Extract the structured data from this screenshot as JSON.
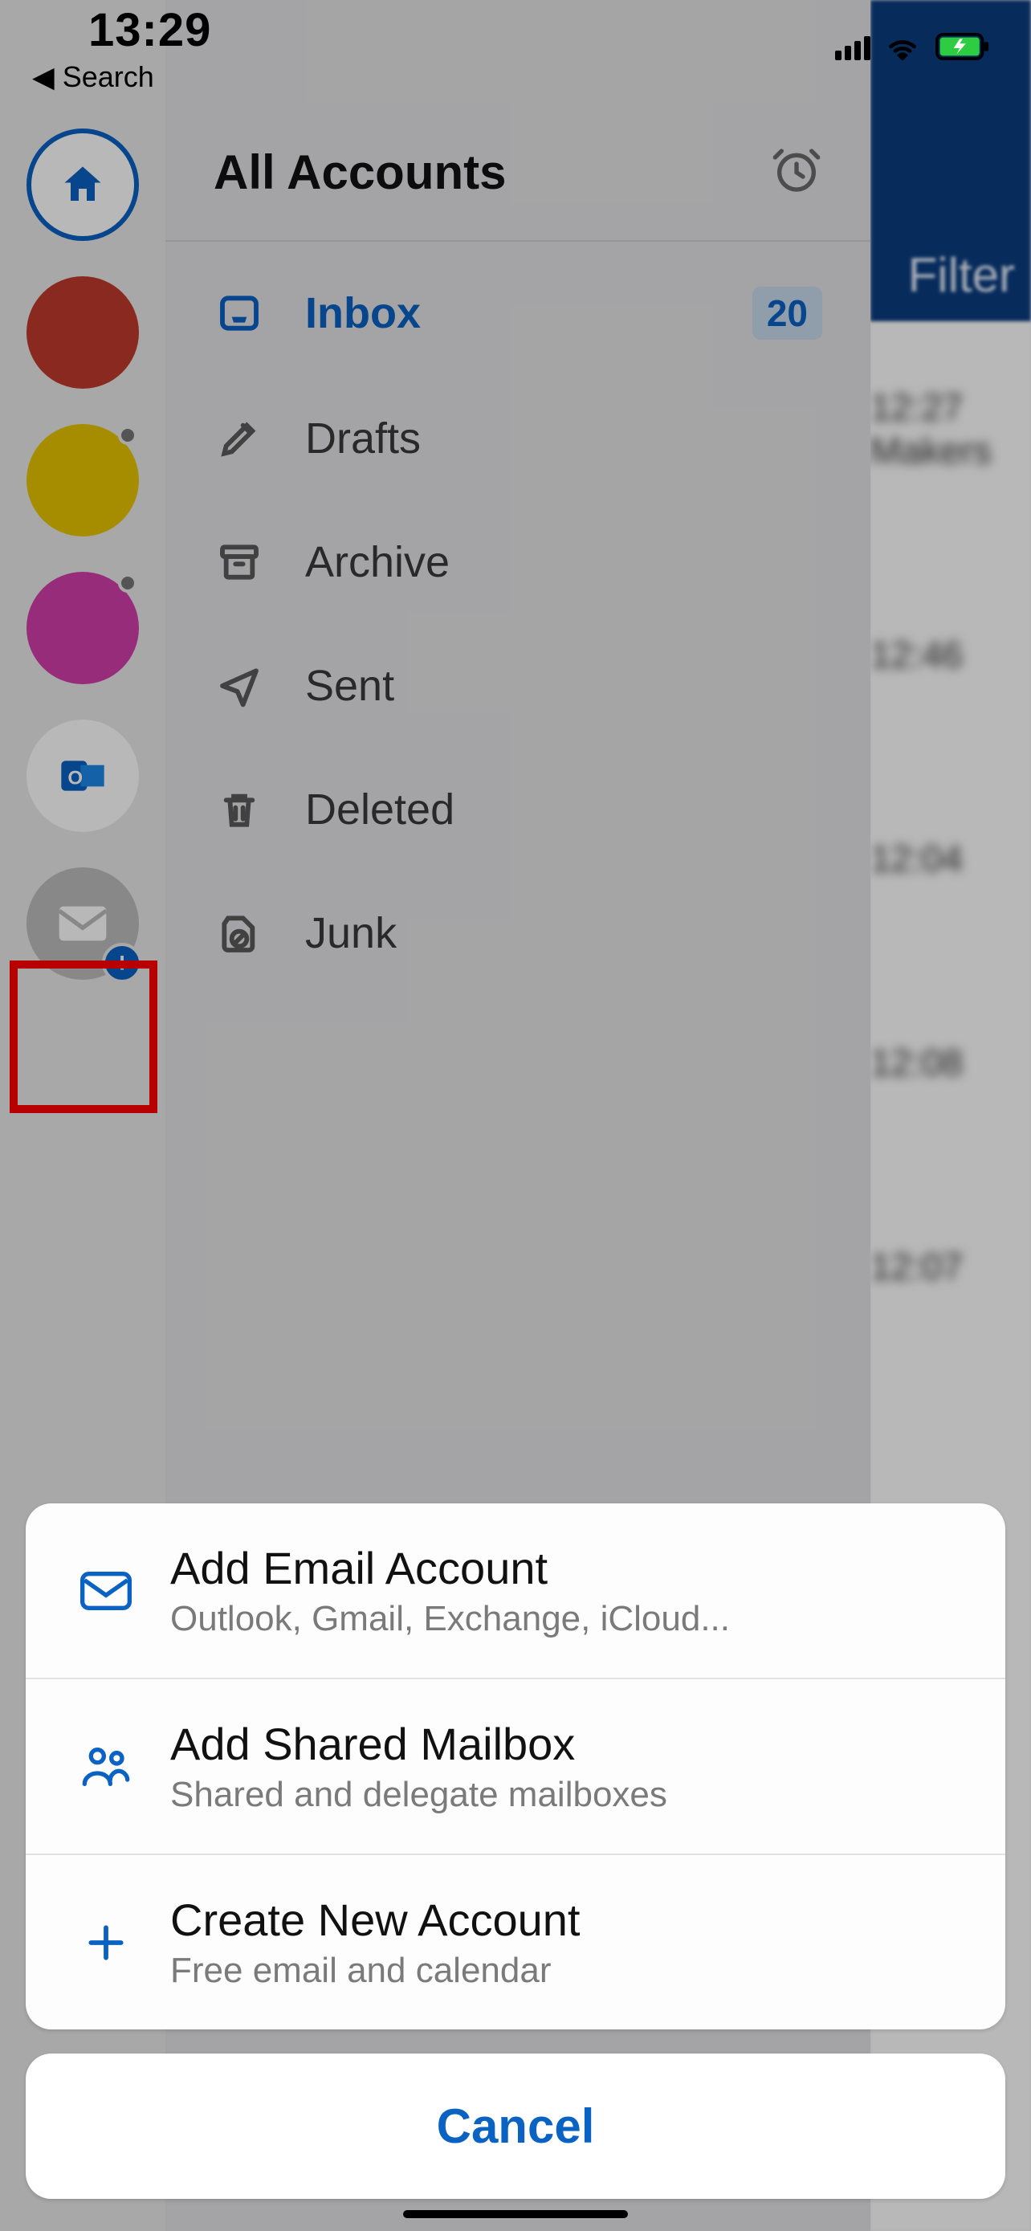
{
  "status": {
    "time": "13:29",
    "back_label": "◀ Search"
  },
  "drawer": {
    "title": "All Accounts",
    "folders": {
      "inbox": {
        "label": "Inbox",
        "badge": "20"
      },
      "drafts": {
        "label": "Drafts"
      },
      "archive": {
        "label": "Archive"
      },
      "sent": {
        "label": "Sent"
      },
      "deleted": {
        "label": "Deleted"
      },
      "junk": {
        "label": "Junk"
      }
    }
  },
  "background": {
    "filter_label": "Filter"
  },
  "sheet": {
    "add_email": {
      "title": "Add Email Account",
      "subtitle": "Outlook, Gmail, Exchange, iCloud..."
    },
    "add_shared": {
      "title": "Add Shared Mailbox",
      "subtitle": "Shared and delegate mailboxes"
    },
    "create_new": {
      "title": "Create New Account",
      "subtitle": "Free email and calendar"
    },
    "cancel_label": "Cancel"
  }
}
